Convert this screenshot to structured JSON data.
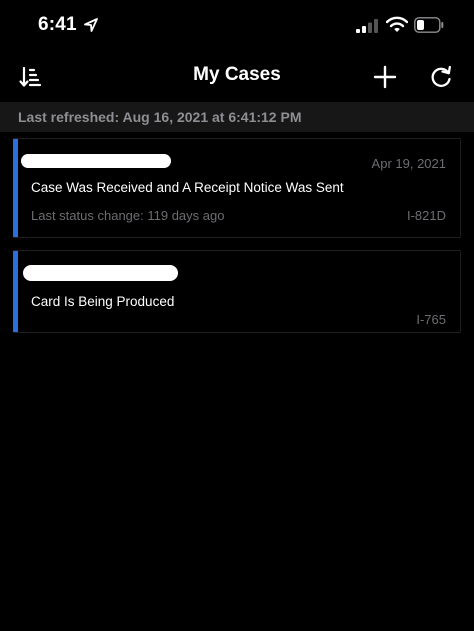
{
  "status_bar": {
    "time": "6:41"
  },
  "nav": {
    "title": "My Cases"
  },
  "refresh": {
    "text": "Last refreshed: Aug 16, 2021 at 6:41:12 PM"
  },
  "cases": [
    {
      "date": "Apr 19, 2021",
      "status": "Case Was Received and A Receipt Notice Was Sent",
      "last_change": "Last status change: 119 days ago",
      "form": "I-821D"
    },
    {
      "date": "",
      "status": "Card Is Being Produced",
      "last_change": "",
      "form": "I-765"
    }
  ],
  "colors": {
    "accent": "#2a6fdb",
    "muted": "#6d6d72",
    "header_bar": "#171717"
  }
}
